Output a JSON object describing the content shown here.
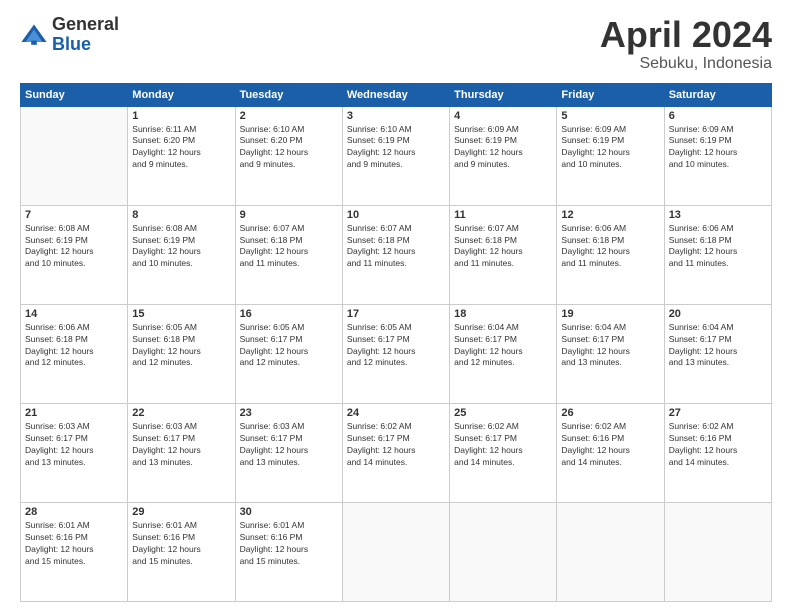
{
  "header": {
    "logo_general": "General",
    "logo_blue": "Blue",
    "month": "April 2024",
    "location": "Sebuku, Indonesia"
  },
  "days_of_week": [
    "Sunday",
    "Monday",
    "Tuesday",
    "Wednesday",
    "Thursday",
    "Friday",
    "Saturday"
  ],
  "weeks": [
    [
      {
        "day": "",
        "info": ""
      },
      {
        "day": "1",
        "info": "Sunrise: 6:11 AM\nSunset: 6:20 PM\nDaylight: 12 hours\nand 9 minutes."
      },
      {
        "day": "2",
        "info": "Sunrise: 6:10 AM\nSunset: 6:20 PM\nDaylight: 12 hours\nand 9 minutes."
      },
      {
        "day": "3",
        "info": "Sunrise: 6:10 AM\nSunset: 6:19 PM\nDaylight: 12 hours\nand 9 minutes."
      },
      {
        "day": "4",
        "info": "Sunrise: 6:09 AM\nSunset: 6:19 PM\nDaylight: 12 hours\nand 9 minutes."
      },
      {
        "day": "5",
        "info": "Sunrise: 6:09 AM\nSunset: 6:19 PM\nDaylight: 12 hours\nand 10 minutes."
      },
      {
        "day": "6",
        "info": "Sunrise: 6:09 AM\nSunset: 6:19 PM\nDaylight: 12 hours\nand 10 minutes."
      }
    ],
    [
      {
        "day": "7",
        "info": "Sunrise: 6:08 AM\nSunset: 6:19 PM\nDaylight: 12 hours\nand 10 minutes."
      },
      {
        "day": "8",
        "info": "Sunrise: 6:08 AM\nSunset: 6:19 PM\nDaylight: 12 hours\nand 10 minutes."
      },
      {
        "day": "9",
        "info": "Sunrise: 6:07 AM\nSunset: 6:18 PM\nDaylight: 12 hours\nand 11 minutes."
      },
      {
        "day": "10",
        "info": "Sunrise: 6:07 AM\nSunset: 6:18 PM\nDaylight: 12 hours\nand 11 minutes."
      },
      {
        "day": "11",
        "info": "Sunrise: 6:07 AM\nSunset: 6:18 PM\nDaylight: 12 hours\nand 11 minutes."
      },
      {
        "day": "12",
        "info": "Sunrise: 6:06 AM\nSunset: 6:18 PM\nDaylight: 12 hours\nand 11 minutes."
      },
      {
        "day": "13",
        "info": "Sunrise: 6:06 AM\nSunset: 6:18 PM\nDaylight: 12 hours\nand 11 minutes."
      }
    ],
    [
      {
        "day": "14",
        "info": "Sunrise: 6:06 AM\nSunset: 6:18 PM\nDaylight: 12 hours\nand 12 minutes."
      },
      {
        "day": "15",
        "info": "Sunrise: 6:05 AM\nSunset: 6:18 PM\nDaylight: 12 hours\nand 12 minutes."
      },
      {
        "day": "16",
        "info": "Sunrise: 6:05 AM\nSunset: 6:17 PM\nDaylight: 12 hours\nand 12 minutes."
      },
      {
        "day": "17",
        "info": "Sunrise: 6:05 AM\nSunset: 6:17 PM\nDaylight: 12 hours\nand 12 minutes."
      },
      {
        "day": "18",
        "info": "Sunrise: 6:04 AM\nSunset: 6:17 PM\nDaylight: 12 hours\nand 12 minutes."
      },
      {
        "day": "19",
        "info": "Sunrise: 6:04 AM\nSunset: 6:17 PM\nDaylight: 12 hours\nand 13 minutes."
      },
      {
        "day": "20",
        "info": "Sunrise: 6:04 AM\nSunset: 6:17 PM\nDaylight: 12 hours\nand 13 minutes."
      }
    ],
    [
      {
        "day": "21",
        "info": "Sunrise: 6:03 AM\nSunset: 6:17 PM\nDaylight: 12 hours\nand 13 minutes."
      },
      {
        "day": "22",
        "info": "Sunrise: 6:03 AM\nSunset: 6:17 PM\nDaylight: 12 hours\nand 13 minutes."
      },
      {
        "day": "23",
        "info": "Sunrise: 6:03 AM\nSunset: 6:17 PM\nDaylight: 12 hours\nand 13 minutes."
      },
      {
        "day": "24",
        "info": "Sunrise: 6:02 AM\nSunset: 6:17 PM\nDaylight: 12 hours\nand 14 minutes."
      },
      {
        "day": "25",
        "info": "Sunrise: 6:02 AM\nSunset: 6:17 PM\nDaylight: 12 hours\nand 14 minutes."
      },
      {
        "day": "26",
        "info": "Sunrise: 6:02 AM\nSunset: 6:16 PM\nDaylight: 12 hours\nand 14 minutes."
      },
      {
        "day": "27",
        "info": "Sunrise: 6:02 AM\nSunset: 6:16 PM\nDaylight: 12 hours\nand 14 minutes."
      }
    ],
    [
      {
        "day": "28",
        "info": "Sunrise: 6:01 AM\nSunset: 6:16 PM\nDaylight: 12 hours\nand 15 minutes."
      },
      {
        "day": "29",
        "info": "Sunrise: 6:01 AM\nSunset: 6:16 PM\nDaylight: 12 hours\nand 15 minutes."
      },
      {
        "day": "30",
        "info": "Sunrise: 6:01 AM\nSunset: 6:16 PM\nDaylight: 12 hours\nand 15 minutes."
      },
      {
        "day": "",
        "info": ""
      },
      {
        "day": "",
        "info": ""
      },
      {
        "day": "",
        "info": ""
      },
      {
        "day": "",
        "info": ""
      }
    ]
  ]
}
